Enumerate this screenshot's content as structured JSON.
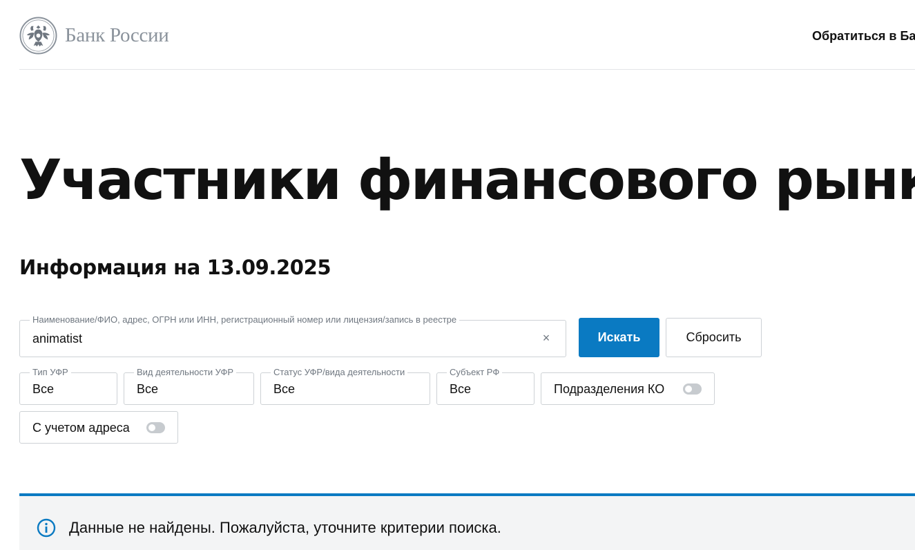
{
  "header": {
    "logo_text": "Банк России",
    "logo_icon": "double-headed-eagle-emblem",
    "contact_link": "Обратиться в Бан"
  },
  "main": {
    "title": "Участники финансового рынка",
    "info_date": "Информация на 13.09.2025"
  },
  "search": {
    "legend": "Наименование/ФИО, адрес, ОГРН или ИНН, регистрационный номер или лицензия/запись в реестре",
    "value": "animatist",
    "clear_symbol": "×",
    "search_button": "Искать",
    "reset_button": "Сбросить"
  },
  "filters": {
    "type": {
      "legend": "Тип УФР",
      "value": "Все"
    },
    "activity": {
      "legend": "Вид деятельности УФР",
      "value": "Все"
    },
    "status": {
      "legend": "Статус УФР/вида деятельности",
      "value": "Все"
    },
    "region": {
      "legend": "Субъект РФ",
      "value": "Все"
    }
  },
  "toggles": {
    "ko_divisions": {
      "label": "Подразделения КО",
      "on": false
    },
    "with_address": {
      "label": "С учетом адреса",
      "on": false
    }
  },
  "notice": {
    "text": "Данные не найдены. Пожалуйста, уточните критерии поиска.",
    "icon": "info-icon"
  },
  "colors": {
    "accent": "#0a7ac2",
    "logo_gray": "#8a929b",
    "notice_bg": "#f3f4f5"
  }
}
